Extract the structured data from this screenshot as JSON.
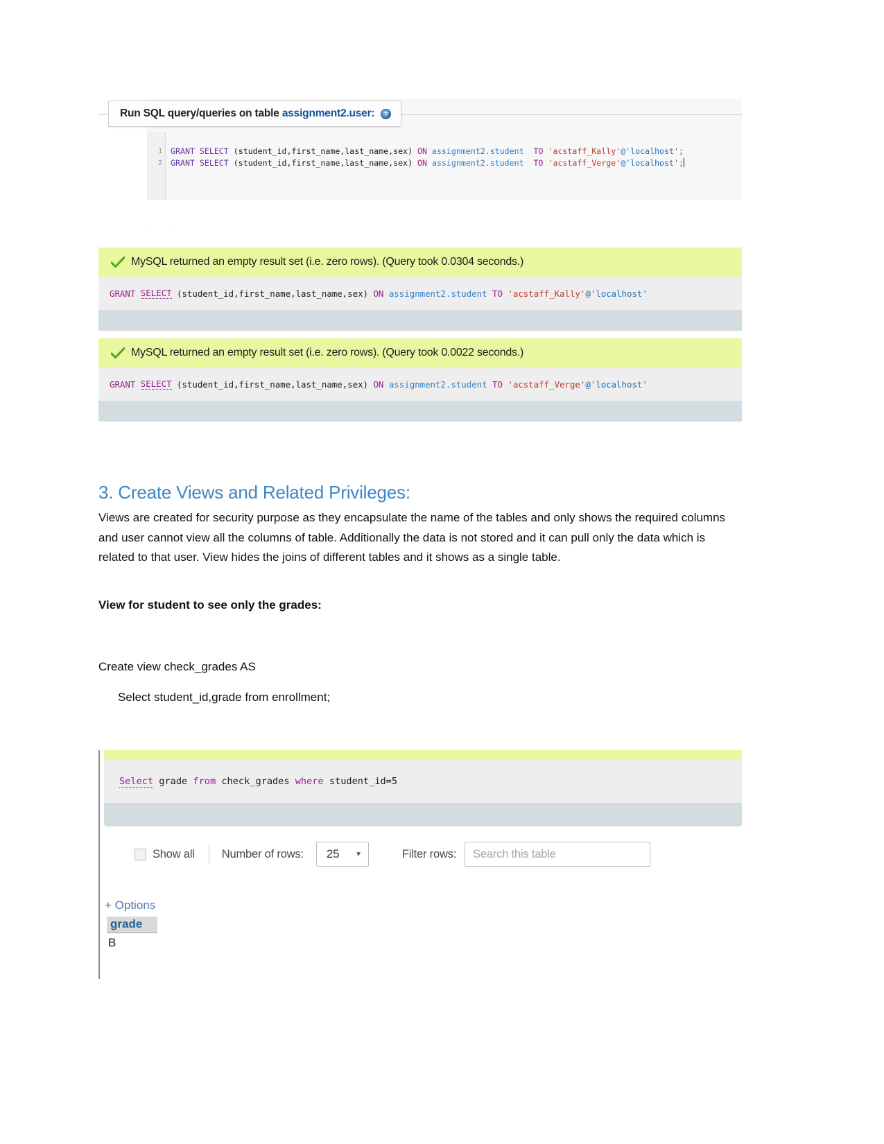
{
  "sql_panel": {
    "legend_prefix": "Run SQL query/queries on table ",
    "legend_table": "assignment2.user:",
    "help_icon": "help-icon",
    "lines": [
      {
        "number": "1",
        "grant": "GRANT",
        "select": "SELECT",
        "columns": " (student_id,first_name,last_name,sex) ",
        "on": "ON",
        "table": " assignment2.student  ",
        "to": "TO",
        "user": " 'acstaff_Kally'",
        "at": "@",
        "host": "'localhost';"
      },
      {
        "number": "2",
        "grant": "GRANT",
        "select": "SELECT",
        "columns": " (student_id,first_name,last_name,sex) ",
        "on": "ON",
        "table": " assignment2.student  ",
        "to": "TO",
        "user": " 'acstaff_Verge'",
        "at": "@",
        "host": "'localhost';"
      }
    ]
  },
  "results": [
    {
      "message": "MySQL returned an empty result set (i.e. zero rows). (Query took 0.0304 seconds.)",
      "sql": {
        "grant": "GRANT ",
        "select": "SELECT",
        "columns": " (student_id,first_name,last_name,sex) ",
        "on": "ON",
        "table": " assignment2.student ",
        "to": "TO",
        "user": " 'acstaff_Kally'",
        "at": "@",
        "host": "'localhost'"
      }
    },
    {
      "message": "MySQL returned an empty result set (i.e. zero rows). (Query took 0.0022 seconds.)",
      "sql": {
        "grant": "GRANT ",
        "select": "SELECT",
        "columns": " (student_id,first_name,last_name,sex) ",
        "on": "ON",
        "table": " assignment2.student ",
        "to": "TO",
        "user": " 'acstaff_Verge'",
        "at": "@",
        "host": "'localhost'"
      }
    }
  ],
  "document": {
    "heading": "3. Create Views and Related Privileges:",
    "paragraph": "Views are created for security purpose as they encapsulate the name of the tables and only shows the required columns and user cannot view all the columns of table. Additionally the data is not stored and it can pull only the data which is related to that user. View hides the joins of different tables and it shows as a single table.",
    "bold_subheading": "View for student to see only the grades:",
    "create_view_line": "Create view check_grades AS",
    "select_line": "Select student_id,grade from enrollment;"
  },
  "view_result": {
    "sql": {
      "select": "Select",
      "mid1": " grade ",
      "from": "from",
      "mid2": " check_grades ",
      "where": "where",
      "mid3": " student_id=5"
    },
    "controls": {
      "show_all_label": "Show all",
      "number_of_rows_label": "Number of rows:",
      "rows_value": "25",
      "caret_icon": "chevron-down-icon",
      "filter_rows_label": "Filter rows:",
      "filter_placeholder": "Search this table"
    },
    "options_link": "+ Options",
    "table": {
      "columns": [
        "grade"
      ],
      "rows": [
        [
          "B"
        ]
      ]
    }
  },
  "colors": {
    "accent_heading": "#3d85c6",
    "success_bg": "#eaf7a0",
    "panel_bg": "#eeeeee",
    "footer_bg": "#d3dce0",
    "link": "#4a7cab"
  }
}
